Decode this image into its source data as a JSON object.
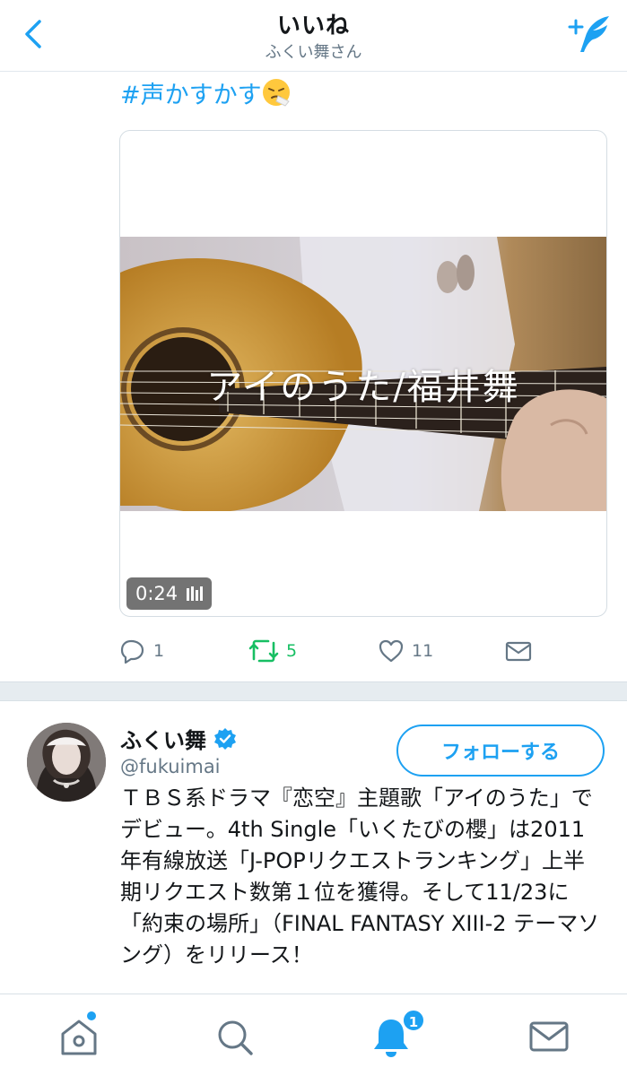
{
  "header": {
    "title": "いいね",
    "subtitle": "ふくい舞さん",
    "back_icon": "chevron-left-icon",
    "compose_icon": "compose-tweet-icon"
  },
  "tweet": {
    "text": "#声かすかす",
    "emoji": "sneezing-face-emoji",
    "media": {
      "overlay_title": "アイのうた/福井舞",
      "duration": "0:24"
    },
    "actions": {
      "reply_count": "1",
      "retweet_count": "5",
      "like_count": "11"
    }
  },
  "profile": {
    "name": "ふくい舞",
    "handle": "@fukuimai",
    "follow_label": "フォローする",
    "bio": "ＴＢＳ系ドラマ『恋空』主題歌「アイのうた」でデビュー。4th Single「いくたびの櫻」は2011年有線放送「J-POPリクエストランキング」上半期リクエスト数第１位を獲得。そして11/23に「約束の場所」（FINAL FANTASY XIII-2 テーマソング）をリリース！"
  },
  "tabbar": {
    "notifications_badge": "1"
  },
  "colors": {
    "accent": "#1da1f2",
    "retweet": "#17bf63",
    "muted": "#657786",
    "divider": "#e6ecf0"
  }
}
